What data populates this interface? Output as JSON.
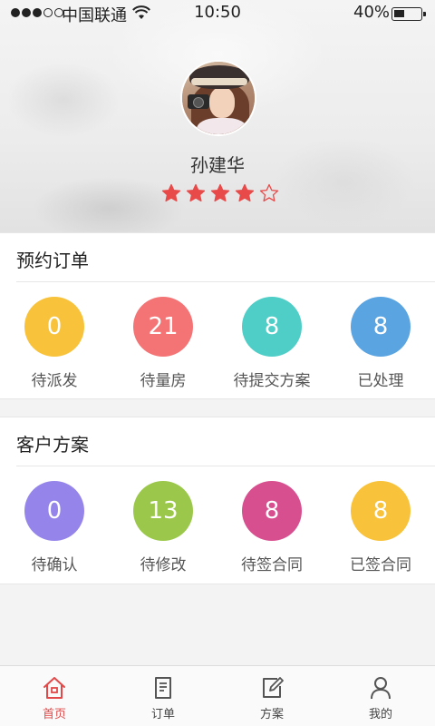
{
  "status_bar": {
    "carrier": "中国联通",
    "time": "10:50",
    "battery_percent": "40%",
    "battery_level": 0.4,
    "signal_strength": 3
  },
  "profile": {
    "name": "孙建华",
    "rating": 4,
    "rating_max": 5,
    "star_color": "#e84a4a"
  },
  "booking_orders": {
    "title": "预约订单",
    "stats": [
      {
        "value": "0",
        "label": "待派发",
        "color": "#f8c33a"
      },
      {
        "value": "21",
        "label": "待量房",
        "color": "#f47475"
      },
      {
        "value": "8",
        "label": "待提交方案",
        "color": "#4ecec7"
      },
      {
        "value": "8",
        "label": "已处理",
        "color": "#5ba4e2"
      }
    ]
  },
  "customer_plans": {
    "title": "客户方案",
    "stats": [
      {
        "value": "0",
        "label": "待确认",
        "color": "#9585ea"
      },
      {
        "value": "13",
        "label": "待修改",
        "color": "#9bc84a"
      },
      {
        "value": "8",
        "label": "待签合同",
        "color": "#d84f8f"
      },
      {
        "value": "8",
        "label": "已签合同",
        "color": "#f8c33a"
      }
    ]
  },
  "tab_bar": {
    "items": [
      {
        "label": "首页",
        "icon": "home-icon",
        "active": true
      },
      {
        "label": "订单",
        "icon": "order-icon",
        "active": false
      },
      {
        "label": "方案",
        "icon": "edit-icon",
        "active": false
      },
      {
        "label": "我的",
        "icon": "profile-icon",
        "active": false
      }
    ],
    "active_color": "#e24848"
  }
}
